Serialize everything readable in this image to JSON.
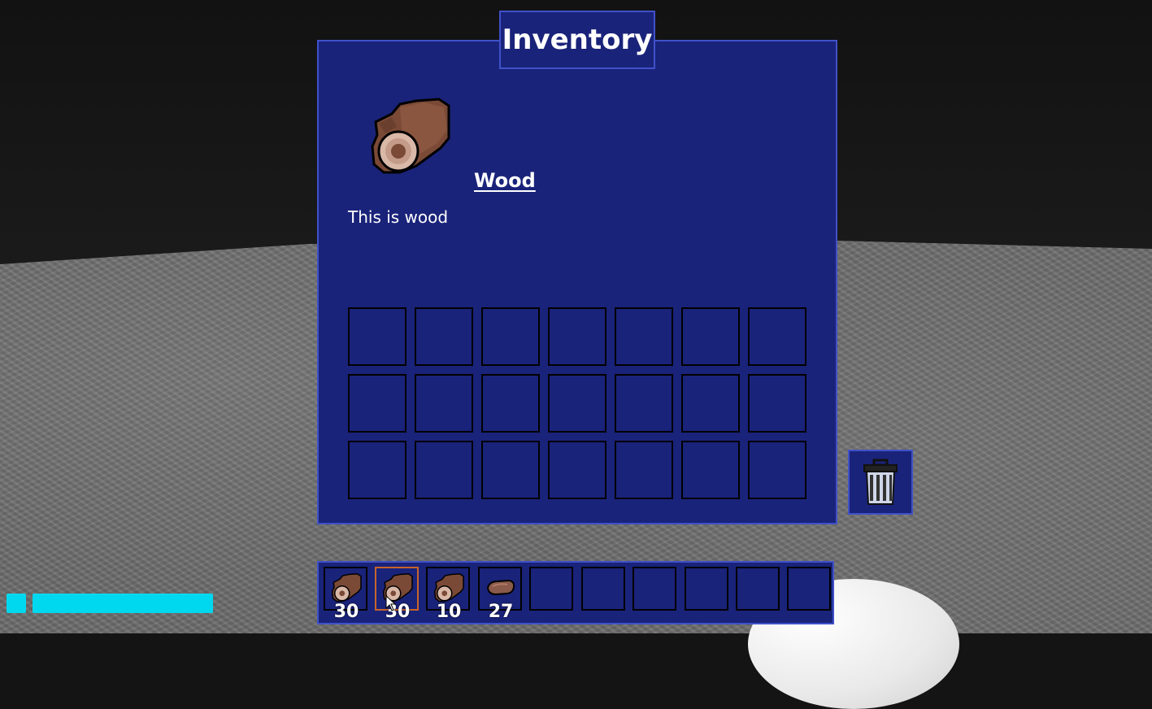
{
  "inventory": {
    "title": "Inventory",
    "selected_item": {
      "name": "Wood",
      "description": "This is wood",
      "icon": "wood-log-icon"
    },
    "grid": {
      "rows": 3,
      "columns": 7
    }
  },
  "trash": {
    "icon": "trash-can-icon"
  },
  "hotbar": {
    "slots": [
      {
        "icon": "wood-log-icon",
        "count": "30",
        "selected": false
      },
      {
        "icon": "wood-log-icon",
        "count": "30",
        "selected": true
      },
      {
        "icon": "wood-log-icon",
        "count": "10",
        "selected": false
      },
      {
        "icon": "meat-icon",
        "count": "27",
        "selected": false
      },
      {
        "icon": "",
        "count": "",
        "selected": false
      },
      {
        "icon": "",
        "count": "",
        "selected": false
      },
      {
        "icon": "",
        "count": "",
        "selected": false
      },
      {
        "icon": "",
        "count": "",
        "selected": false
      },
      {
        "icon": "",
        "count": "",
        "selected": false
      },
      {
        "icon": "",
        "count": "",
        "selected": false
      }
    ]
  },
  "status": {
    "stamina_fraction": 1.0
  },
  "colors": {
    "panel": "#1a237a",
    "panel_border": "#3f51c9",
    "selected_border": "#c8642a",
    "stamina": "#00d8f0"
  }
}
